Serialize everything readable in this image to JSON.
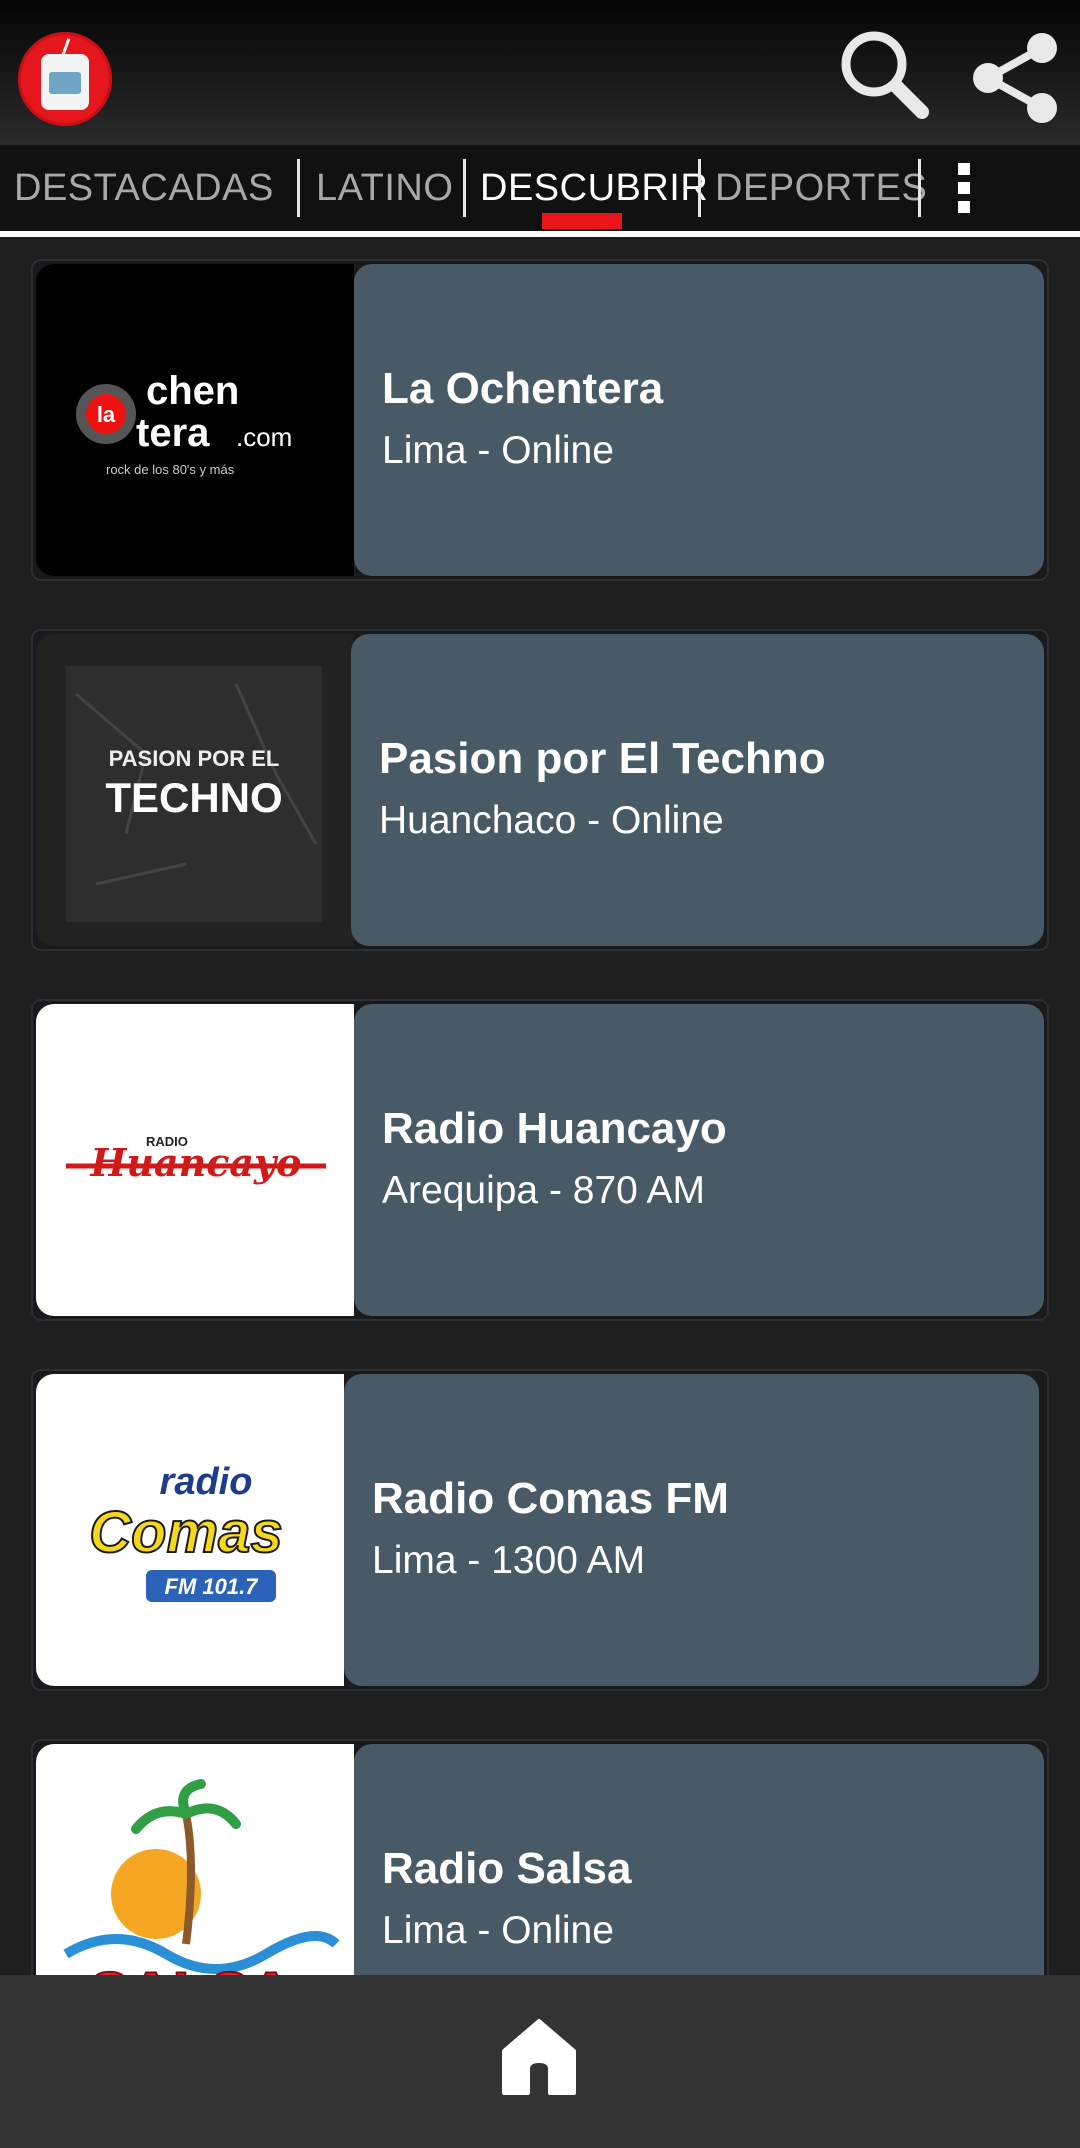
{
  "header": {
    "app_icon": "radio-app-icon",
    "search_icon": "search-icon",
    "share_icon": "share-icon"
  },
  "tabs": [
    {
      "label": "DESTACADAS",
      "active": false
    },
    {
      "label": "LATINO",
      "active": false
    },
    {
      "label": "DESCUBRIR",
      "active": true
    },
    {
      "label": "DEPORTES",
      "active": false
    }
  ],
  "overflow_icon": "more-vert-icon",
  "stations": [
    {
      "name": "La Ochentera",
      "location": "Lima - Online",
      "logo_text": [
        "la",
        "chen",
        "tera",
        ".com",
        "rock de los 80's y más"
      ]
    },
    {
      "name": "Pasion por El Techno",
      "location": "Huanchaco - Online",
      "logo_text": [
        "PASION POR EL",
        "TECHNO"
      ]
    },
    {
      "name": "Radio Huancayo",
      "location": "Arequipa - 870 AM",
      "logo_text": [
        "RADIO",
        "Huancayo"
      ]
    },
    {
      "name": "Radio Comas FM",
      "location": "Lima - 1300 AM",
      "logo_text": [
        "radio",
        "Comas",
        "FM 101.7"
      ]
    },
    {
      "name": "Radio Salsa",
      "location": "Lima - Online",
      "logo_text": [
        "SALSA"
      ]
    }
  ],
  "bottom_nav": {
    "home_icon": "home-icon"
  },
  "colors": {
    "accent": "#e8151b",
    "card": "#475a66",
    "bar": "#333333"
  }
}
